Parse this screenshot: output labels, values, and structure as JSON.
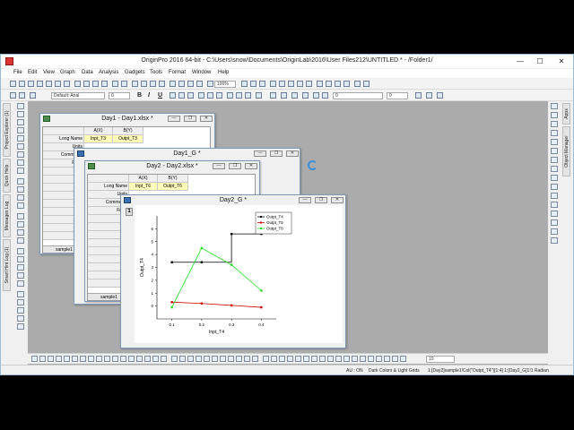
{
  "app": {
    "title": "OriginPro 2016 64-bit - C:\\Users\\snow\\Documents\\OriginLab\\2016\\User Files212\\UNTITLED * - /Folder1/",
    "win_min": "—",
    "win_max": "☐",
    "win_close": "✕"
  },
  "menu": [
    "File",
    "Edit",
    "View",
    "Graph",
    "Data",
    "Analysis",
    "Gadgets",
    "Tools",
    "Format",
    "Window",
    "Help"
  ],
  "toolbar": {
    "zoom": "100%",
    "font": "Default: Arial",
    "font_size": "0",
    "bold": "B",
    "italic": "I",
    "underline": "U",
    "line_width": "0",
    "line_size": "0"
  },
  "left_dock_tabs": [
    "Project Explorer (1)",
    "Quick Help",
    "Messages Log",
    "Smart Hint Log (1)"
  ],
  "right_dock_tabs": [
    "Apps",
    "Object Manager"
  ],
  "bottom_bar": {
    "zoom_field": "10"
  },
  "status": {
    "au": "AU : ON",
    "theme": "Dark Colors & Light Grids",
    "selection": "1:[Day2]sample1!Col(\"Outpt_T4\")[1:4]  1:[Day2_G]1!1  Radian"
  },
  "windows": {
    "day1_book": {
      "title": "Day1 - Day1.xlsx *",
      "col_a": "A(X)",
      "col_b": "B(Y)",
      "long_name_label": "Long Name",
      "units_label": "Units",
      "comments_label": "Comments",
      "f_label": "F(x)=",
      "a_long_name": "Inpt_T3",
      "b_long_name": "Outpt_T3",
      "sheet_tab": "sample1"
    },
    "day1_graph": {
      "title": "Day1_G *"
    },
    "day2_book": {
      "title": "Day2 - Day2.xlsx *",
      "col_a": "A(X)",
      "col_b": "B(Y)",
      "long_name_label": "Long Name",
      "units_label": "Units",
      "comments_label": "Comments",
      "f_label": "F(x)=",
      "a_long_name": "Inpt_T6",
      "b_long_name": "Outpt_T6",
      "sheet_tab": "sample1"
    },
    "day2_graph": {
      "title": "Day2_G *",
      "layer_label": "1"
    }
  },
  "chart_data": {
    "type": "line",
    "xlabel": "Inpt_T4",
    "ylabel": "Outpt_T4",
    "xlim": [
      0.05,
      0.45
    ],
    "ylim": [
      -1,
      7
    ],
    "x_ticks": [
      "0.1",
      "0.2",
      "0.3",
      "0.4"
    ],
    "y_ticks": [
      "0",
      "1",
      "2",
      "3",
      "4",
      "5",
      "6"
    ],
    "x": [
      0.1,
      0.2,
      0.3,
      0.4
    ],
    "series": [
      {
        "name": "Outpt_T4",
        "color": "#000000",
        "values": [
          3.4,
          3.4,
          5.6,
          5.6
        ],
        "style": "step"
      },
      {
        "name": "Outpt_T5",
        "color": "#cc0000",
        "values": [
          0.3,
          0.2,
          0.05,
          -0.1
        ],
        "style": "line"
      },
      {
        "name": "Outpt_T6",
        "color": "#22dd22",
        "values": [
          -0.1,
          4.5,
          3.2,
          1.2
        ],
        "style": "line"
      }
    ],
    "legend_position": "top-right",
    "grid": false
  }
}
